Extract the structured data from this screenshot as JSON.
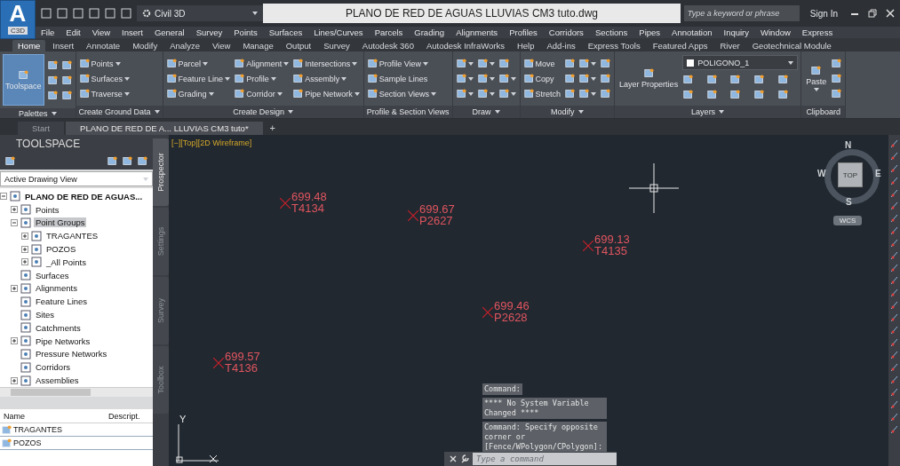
{
  "app_logo": {
    "letter": "A",
    "badge": "C3D"
  },
  "workspace": "Civil 3D",
  "window": {
    "title": "PLANO DE RED DE AGUAS LLUVIAS CM3 tuto.dwg"
  },
  "search": {
    "placeholder": "Type a keyword or phrase"
  },
  "sign_in": "Sign In",
  "menu": [
    "File",
    "Edit",
    "View",
    "Insert",
    "General",
    "Survey",
    "Points",
    "Surfaces",
    "Lines/Curves",
    "Parcels",
    "Grading",
    "Alignments",
    "Profiles",
    "Corridors",
    "Sections",
    "Pipes",
    "Annotation",
    "Inquiry",
    "Window",
    "Express"
  ],
  "ribbon_tabs": [
    {
      "label": "Home",
      "selected": true
    },
    {
      "label": "Insert",
      "selected": false
    },
    {
      "label": "Annotate",
      "selected": false
    },
    {
      "label": "Modify",
      "selected": false
    },
    {
      "label": "Analyze",
      "selected": false
    },
    {
      "label": "View",
      "selected": false
    },
    {
      "label": "Manage",
      "selected": false
    },
    {
      "label": "Output",
      "selected": false
    },
    {
      "label": "Survey",
      "selected": false
    },
    {
      "label": "Autodesk 360",
      "selected": false
    },
    {
      "label": "Autodesk InfraWorks",
      "selected": false
    },
    {
      "label": "Help",
      "selected": false
    },
    {
      "label": "Add-ins",
      "selected": false
    },
    {
      "label": "Express Tools",
      "selected": false
    },
    {
      "label": "Featured Apps",
      "selected": false
    },
    {
      "label": "River",
      "selected": false
    },
    {
      "label": "Geotechnical Module",
      "selected": false
    }
  ],
  "ribbon_panels": [
    {
      "title": "Palettes",
      "menu": true,
      "big": {
        "label": "Toolspace",
        "on": true,
        "dropdown": false
      },
      "items": [
        {
          "dropdown": false
        },
        {
          "dropdown": false
        },
        {
          "dropdown": false
        },
        {
          "dropdown": false
        },
        {
          "dropdown": false
        },
        {
          "dropdown": false
        }
      ]
    },
    {
      "title": "Create Ground Data",
      "menu": true,
      "items": [
        {
          "label": "Points",
          "dropdown": true
        },
        {
          "label": "Surfaces",
          "dropdown": true
        },
        {
          "label": "Traverse",
          "dropdown": true
        }
      ]
    },
    {
      "title": "Create Design",
      "menu": true,
      "items": [
        {
          "label": "Parcel",
          "dropdown": true
        },
        {
          "label": "Feature Line",
          "dropdown": true
        },
        {
          "label": "Grading",
          "dropdown": true
        },
        {
          "label": "Alignment",
          "dropdown": true
        },
        {
          "label": "Profile",
          "dropdown": true
        },
        {
          "label": "Corridor",
          "dropdown": true
        },
        {
          "label": "Intersections",
          "dropdown": true
        },
        {
          "label": "Assembly",
          "dropdown": true
        },
        {
          "label": "Pipe Network",
          "dropdown": true
        }
      ]
    },
    {
      "title": "Profile & Section Views",
      "menu": false,
      "items": [
        {
          "label": "Profile View",
          "dropdown": true
        },
        {
          "label": "Sample Lines",
          "dropdown": false
        },
        {
          "label": "Section Views",
          "dropdown": true
        }
      ]
    },
    {
      "title": "Draw",
      "menu": true,
      "items": [
        {
          "dropdown": true
        },
        {
          "dropdown": true
        },
        {
          "dropdown": true
        },
        {
          "dropdown": true
        },
        {
          "dropdown": true
        },
        {
          "dropdown": true
        },
        {
          "dropdown": false
        },
        {
          "dropdown": true
        },
        {
          "dropdown": true
        }
      ]
    },
    {
      "title": "Modify",
      "menu": true,
      "items": [
        {
          "label": "Move",
          "dropdown": false
        },
        {
          "label": "Copy",
          "dropdown": false
        },
        {
          "label": "Stretch",
          "dropdown": false
        },
        {
          "dropdown": false
        },
        {
          "dropdown": false
        },
        {
          "dropdown": false
        },
        {
          "dropdown": true
        },
        {
          "dropdown": true
        },
        {
          "dropdown": true
        },
        {
          "dropdown": false
        },
        {
          "dropdown": false
        },
        {
          "dropdown": false
        }
      ]
    },
    {
      "title": "Layers",
      "menu": true,
      "big": {
        "label": "Layer Properties",
        "on": false,
        "dropdown": false
      },
      "layer_select": "POLIGONO_1",
      "items": [
        {
          "dropdown": false
        },
        {
          "dropdown": false
        },
        {
          "dropdown": false
        },
        {
          "dropdown": false
        },
        {
          "dropdown": false
        },
        {
          "dropdown": false
        },
        {
          "dropdown": false
        },
        {
          "dropdown": false
        },
        {
          "dropdown": false
        },
        {
          "dropdown": false
        }
      ]
    },
    {
      "title": "Clipboard",
      "menu": false,
      "big": {
        "label": "Paste",
        "on": false,
        "dropdown": true
      },
      "items": [
        {
          "dropdown": false
        },
        {
          "dropdown": false
        },
        {
          "dropdown": false
        }
      ]
    }
  ],
  "doc_tabs": [
    {
      "label": "Start",
      "selected": false
    },
    {
      "label": "PLANO DE RED DE A... LLUVIAS CM3 tuto*",
      "selected": true
    }
  ],
  "new_tab": "+",
  "toolspace": {
    "title": "TOOLSPACE",
    "view": "Active Drawing View",
    "tree": [
      {
        "label": "PLANO DE RED DE AGUAS...",
        "expanded": true,
        "selected": false,
        "children": [
          {
            "label": "Points",
            "expanded": false,
            "selected": false
          },
          {
            "label": "Point Groups",
            "expanded": true,
            "selected": true,
            "children": [
              {
                "label": "TRAGANTES",
                "expanded": false,
                "selected": false
              },
              {
                "label": "POZOS",
                "expanded": false,
                "selected": false
              },
              {
                "label": "_All Points",
                "expanded": false,
                "selected": false
              }
            ]
          },
          {
            "label": "Surfaces",
            "selected": false
          },
          {
            "label": "Alignments",
            "expanded": false,
            "selected": false
          },
          {
            "label": "Feature Lines",
            "selected": false
          },
          {
            "label": "Sites",
            "selected": false
          },
          {
            "label": "Catchments",
            "selected": false
          },
          {
            "label": "Pipe Networks",
            "expanded": false,
            "selected": false
          },
          {
            "label": "Pressure Networks",
            "selected": false
          },
          {
            "label": "Corridors",
            "selected": false
          },
          {
            "label": "Assemblies",
            "expanded": false,
            "selected": false
          }
        ]
      }
    ],
    "list": {
      "columns": [
        "Name",
        "Descript."
      ],
      "rows": [
        "TRAGANTES",
        "POZOS"
      ]
    }
  },
  "side_tabs": [
    {
      "label": "Prospector",
      "selected": true
    },
    {
      "label": "Settings",
      "selected": false
    },
    {
      "label": "Survey",
      "selected": false
    },
    {
      "label": "Toolbox",
      "selected": false
    }
  ],
  "viewport": {
    "label": "[−][Top][2D Wireframe]",
    "points": [
      {
        "elevation": "699.48",
        "name": "T4134"
      },
      {
        "elevation": "699.67",
        "name": "P2627"
      },
      {
        "elevation": "699.13",
        "name": "T4135"
      },
      {
        "elevation": "699.46",
        "name": "P2628"
      },
      {
        "elevation": "699.57",
        "name": "T4136"
      }
    ],
    "viewcube": {
      "north": "N",
      "south": "S",
      "east": "E",
      "west": "W",
      "face": "TOP"
    },
    "ucs": "WCS",
    "axis_label": "Y"
  },
  "command": {
    "history": [
      "Command:",
      "**** No System Variable Changed ****",
      "Command: Specify opposite corner or [Fence/WPolygon/CPolygon]:"
    ],
    "placeholder": "Type a command"
  }
}
